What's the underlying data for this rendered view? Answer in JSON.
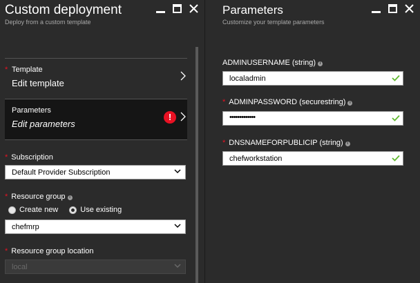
{
  "left_blade": {
    "title": "Custom deployment",
    "subtitle": "Deploy from a custom template",
    "template_row": {
      "label": "Template",
      "value": "Edit template"
    },
    "parameters_row": {
      "label": "Parameters",
      "value": "Edit parameters",
      "status": "error"
    },
    "subscription": {
      "label": "Subscription",
      "value": "Default Provider Subscription"
    },
    "resource_group": {
      "label": "Resource group",
      "options": [
        "Create new",
        "Use existing"
      ],
      "selected": "Use existing",
      "value": "chefmrp"
    },
    "location": {
      "label": "Resource group location",
      "value": "local",
      "disabled": true
    }
  },
  "right_blade": {
    "title": "Parameters",
    "subtitle": "Customize your template parameters",
    "fields": [
      {
        "label": "ADMINUSERNAME (string)",
        "value": "localadmin",
        "required": false
      },
      {
        "label": "ADMINPASSWORD (securestring)",
        "value": "•••••••••••••",
        "required": true
      },
      {
        "label": "DNSNAMEFORPUBLICIP (string)",
        "value": "chefworkstation",
        "required": true
      }
    ]
  },
  "colors": {
    "required": "#e81123",
    "valid": "#5fb82d",
    "blade_bg": "#2b2b2b",
    "selected_row": "#151515"
  }
}
